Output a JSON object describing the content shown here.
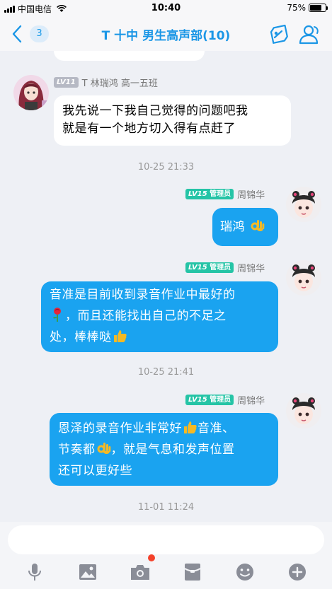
{
  "status_bar": {
    "carrier": "中国电信",
    "time": "10:40",
    "battery": "75%",
    "battery_level": 0.75
  },
  "header": {
    "unread_count": "3",
    "title": "T 十中 男生高声部(10)"
  },
  "messages": [
    {
      "side": "left",
      "level": "LV11",
      "sender": "T 林瑞鸿 高一五班",
      "lines": [
        "我先说一下我自己觉得的问题吧我",
        "就是有一个地方切入得有点赶了"
      ]
    },
    {
      "side": "right",
      "level": "LV15",
      "role": "管理员",
      "sender": "周锦华",
      "lines": [
        "瑞鸿"
      ],
      "emoji": [
        "ok-hand"
      ]
    },
    {
      "side": "right",
      "level": "LV15",
      "role": "管理员",
      "sender": "周锦华",
      "lines": [
        "音准是目前收到录音作业中最好的",
        "，而且还能找出自己的不足之",
        "处，棒棒哒"
      ],
      "emoji": [
        "rose",
        "thumbs-up"
      ]
    },
    {
      "side": "right",
      "level": "LV15",
      "role": "管理员",
      "sender": "周锦华",
      "lines": [
        "恩泽的录音作业非常好",
        "音准、",
        "节奏都",
        "，就是气息和发声位置",
        "还可以更好些"
      ],
      "emoji": [
        "thumbs-up",
        "ok-hand"
      ]
    }
  ],
  "timestamps": [
    "10-25 21:33",
    "10-25 21:41",
    "11-01 11:24"
  ],
  "input": {
    "placeholder": "",
    "value": ""
  },
  "toolbar": [
    "microphone-icon",
    "image-icon",
    "camera-icon",
    "red-packet-icon",
    "emoji-icon",
    "plus-icon"
  ],
  "colors": {
    "accent": "#1aa3f0",
    "title": "#1a96e6",
    "admin_badge": "#25c4a6",
    "dot": "#f4422b"
  }
}
